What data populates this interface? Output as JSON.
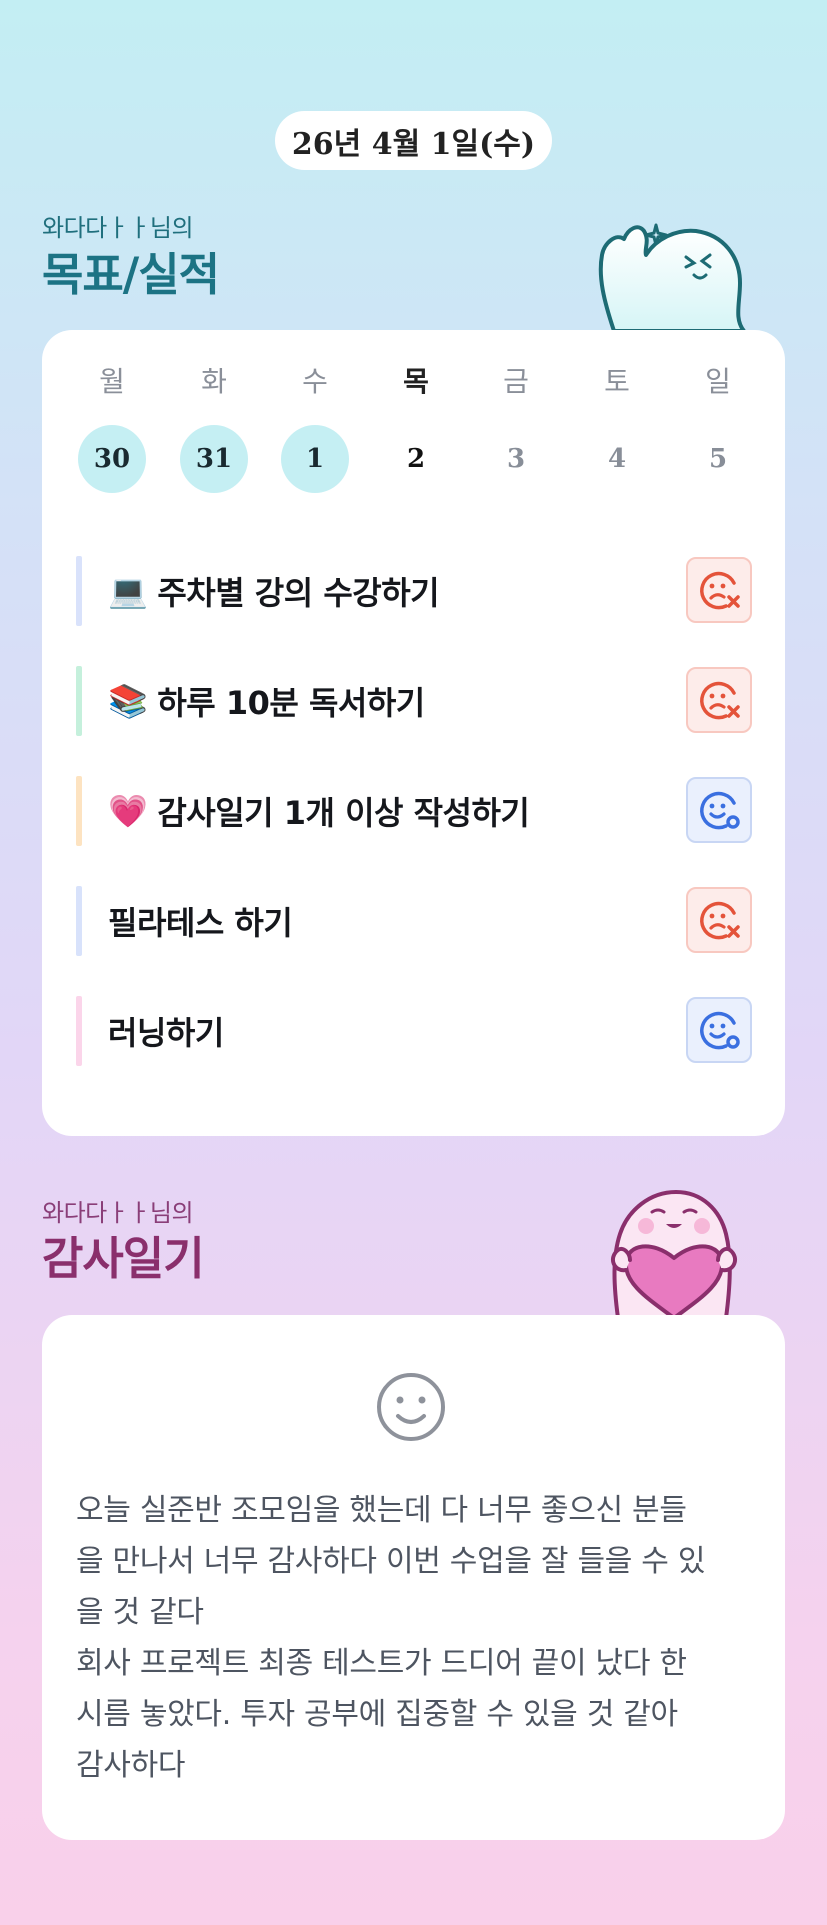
{
  "date_label": "26년 4월 1일(수)",
  "goals_section": {
    "subtitle": "와다다ㅏㅏ님의",
    "title": "목표/실적",
    "weekdays": [
      "월",
      "화",
      "수",
      "목",
      "금",
      "토",
      "일"
    ],
    "dates": [
      "30",
      "31",
      "1",
      "2",
      "3",
      "4",
      "5"
    ],
    "goals": [
      {
        "emoji": "💻",
        "label": "주차별 강의 수강하기",
        "status": "fail",
        "bar_color": "#d9e2fb"
      },
      {
        "emoji": "📚",
        "label": "하루 10분 독서하기",
        "status": "fail",
        "bar_color": "#c5f0dc"
      },
      {
        "emoji": "💗",
        "label": "감사일기 1개 이상 작성하기",
        "status": "done",
        "bar_color": "#fde3c1"
      },
      {
        "emoji": "",
        "label": "필라테스 하기",
        "status": "fail",
        "bar_color": "#d8e2fb"
      },
      {
        "emoji": "",
        "label": "러닝하기",
        "status": "done",
        "bar_color": "#fbd5ea"
      }
    ]
  },
  "gratitude_section": {
    "subtitle": "와다다ㅏㅏ님의",
    "title": "감사일기",
    "mood_icon": "smiley-icon",
    "body": "오늘 실준반 조모임을 했는데 다 너무 좋으신 분들\n을 만나서 너무 감사하다 이번 수업을 잘 들을 수 있\n을 것 같다\n회사 프로젝트 최종 테스트가 드디어 끝이 났다 한\n시름 놓았다. 투자 공부에 집중할 수 있을 것 같아\n감사하다"
  },
  "colors": {
    "goal_title": "#1c7384",
    "gratitude_title": "#8a2f6c",
    "done_circle": "#c5eff3",
    "fail_icon": "#e4533a",
    "done_icon": "#3a6fe0"
  }
}
